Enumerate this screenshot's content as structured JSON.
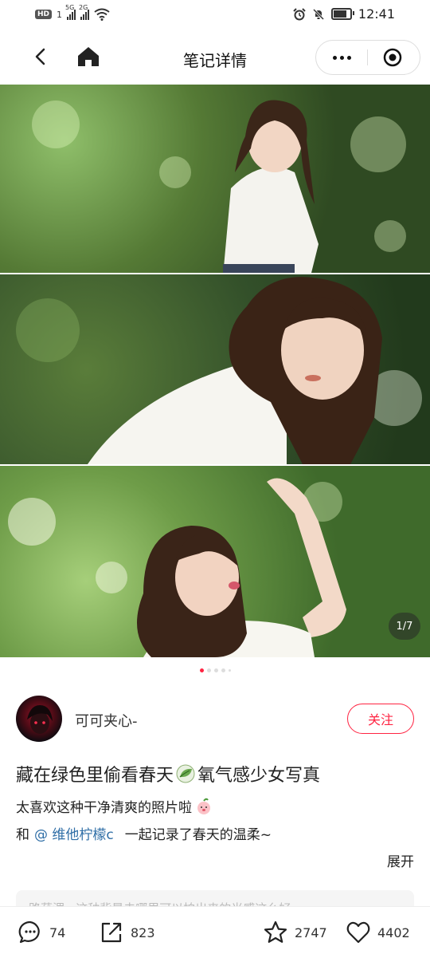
{
  "status_bar": {
    "time": "12:41",
    "left_badges": [
      "HD",
      "1"
    ],
    "network": [
      "5G",
      "2G"
    ],
    "icons": [
      "signal-icon",
      "wifi-icon",
      "alarm-icon",
      "mute-icon",
      "battery-icon"
    ]
  },
  "nav": {
    "title": "笔记详情",
    "back_icon": "chevron-left-icon",
    "home_icon": "home-icon",
    "more_icon": "more-dots-icon",
    "close_icon": "target-icon"
  },
  "gallery": {
    "counter": "1/7",
    "total": 7,
    "current": 1
  },
  "author": {
    "name": "可可夹心-",
    "follow_label": "关注"
  },
  "note": {
    "title_part1": "藏在绿色里偷看春天",
    "title_part2": "氧气感少女写真",
    "body_line1": "太喜欢这种干净清爽的照片啦",
    "body_line2_prefix": "和",
    "mention": "@ 维他柠檬c",
    "body_line2_suffix": "一起记录了春天的温柔~",
    "expand_label": "展开",
    "comment_preview": "路茯湄 · 这种背景去哪里可以拍出来的光感这么好"
  },
  "bottom_bar": {
    "comments": "74",
    "shares": "823",
    "stars": "2747",
    "likes": "4402"
  },
  "colors": {
    "accent": "#ff2442",
    "mention": "#2f6ea6"
  }
}
